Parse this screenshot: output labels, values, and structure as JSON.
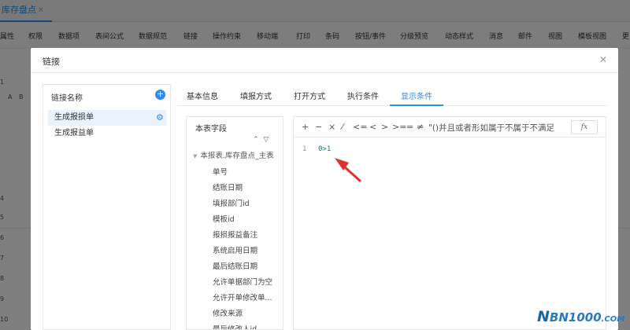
{
  "app": {
    "tab_label": "库存盘点",
    "tab_close": "×",
    "menu": [
      "属性",
      "权限",
      "数据项",
      "表间公式",
      "数据规范",
      "链接",
      "操作约束",
      "移动端",
      "打印",
      "条码",
      "按钮/事件",
      "分级预览",
      "动态样式",
      "消息",
      "邮件",
      "视图",
      "模板视图",
      "更"
    ],
    "sheet_letters": [
      "A",
      "B"
    ],
    "row_numbers": [
      "1",
      "4",
      "5",
      "6",
      "7",
      "8",
      "9",
      "10"
    ]
  },
  "dialog": {
    "title": "链接",
    "close_icon": "✕",
    "left_panel": {
      "title": "链接名称",
      "add_icon": "+",
      "items": [
        {
          "label": "生成报损单",
          "selected": true,
          "gear_icon": "⚙"
        },
        {
          "label": "生成报益单",
          "selected": false
        }
      ]
    },
    "tabs": [
      {
        "label": "基本信息",
        "active": false
      },
      {
        "label": "填报方式",
        "active": false
      },
      {
        "label": "打开方式",
        "active": false
      },
      {
        "label": "执行条件",
        "active": false
      },
      {
        "label": "显示条件",
        "active": true
      }
    ],
    "fields": {
      "title": "本表字段",
      "expand_icon": "⌃",
      "filter_icon": "▽",
      "root": "本报表.库存盘点_主表",
      "root_caret": "▼",
      "items": [
        "单号",
        "结账日期",
        "填报部门id",
        "模板id",
        "报损报益备注",
        "系统启用日期",
        "最后结账日期",
        "允许单据部门为空",
        "允许开单修改单...",
        "修改来源",
        "最后修改人id"
      ]
    },
    "editor": {
      "operators": [
        "+",
        "−",
        "×",
        "⁄",
        "<=",
        "<",
        ">",
        ">=",
        "=",
        "≠"
      ],
      "op_text": "\"()并且或者形如属于不属于不满足",
      "fx_label": "fx",
      "line_number": "1",
      "code": "0>1"
    }
  },
  "watermark": {
    "prefix": "N",
    "middle": "BN1000",
    "suffix": ".COM"
  },
  "colors": {
    "accent": "#2d8cf0",
    "overlay": "rgba(0,0,0,0.5)",
    "code": "#098658",
    "arrow": "#e0332e"
  }
}
